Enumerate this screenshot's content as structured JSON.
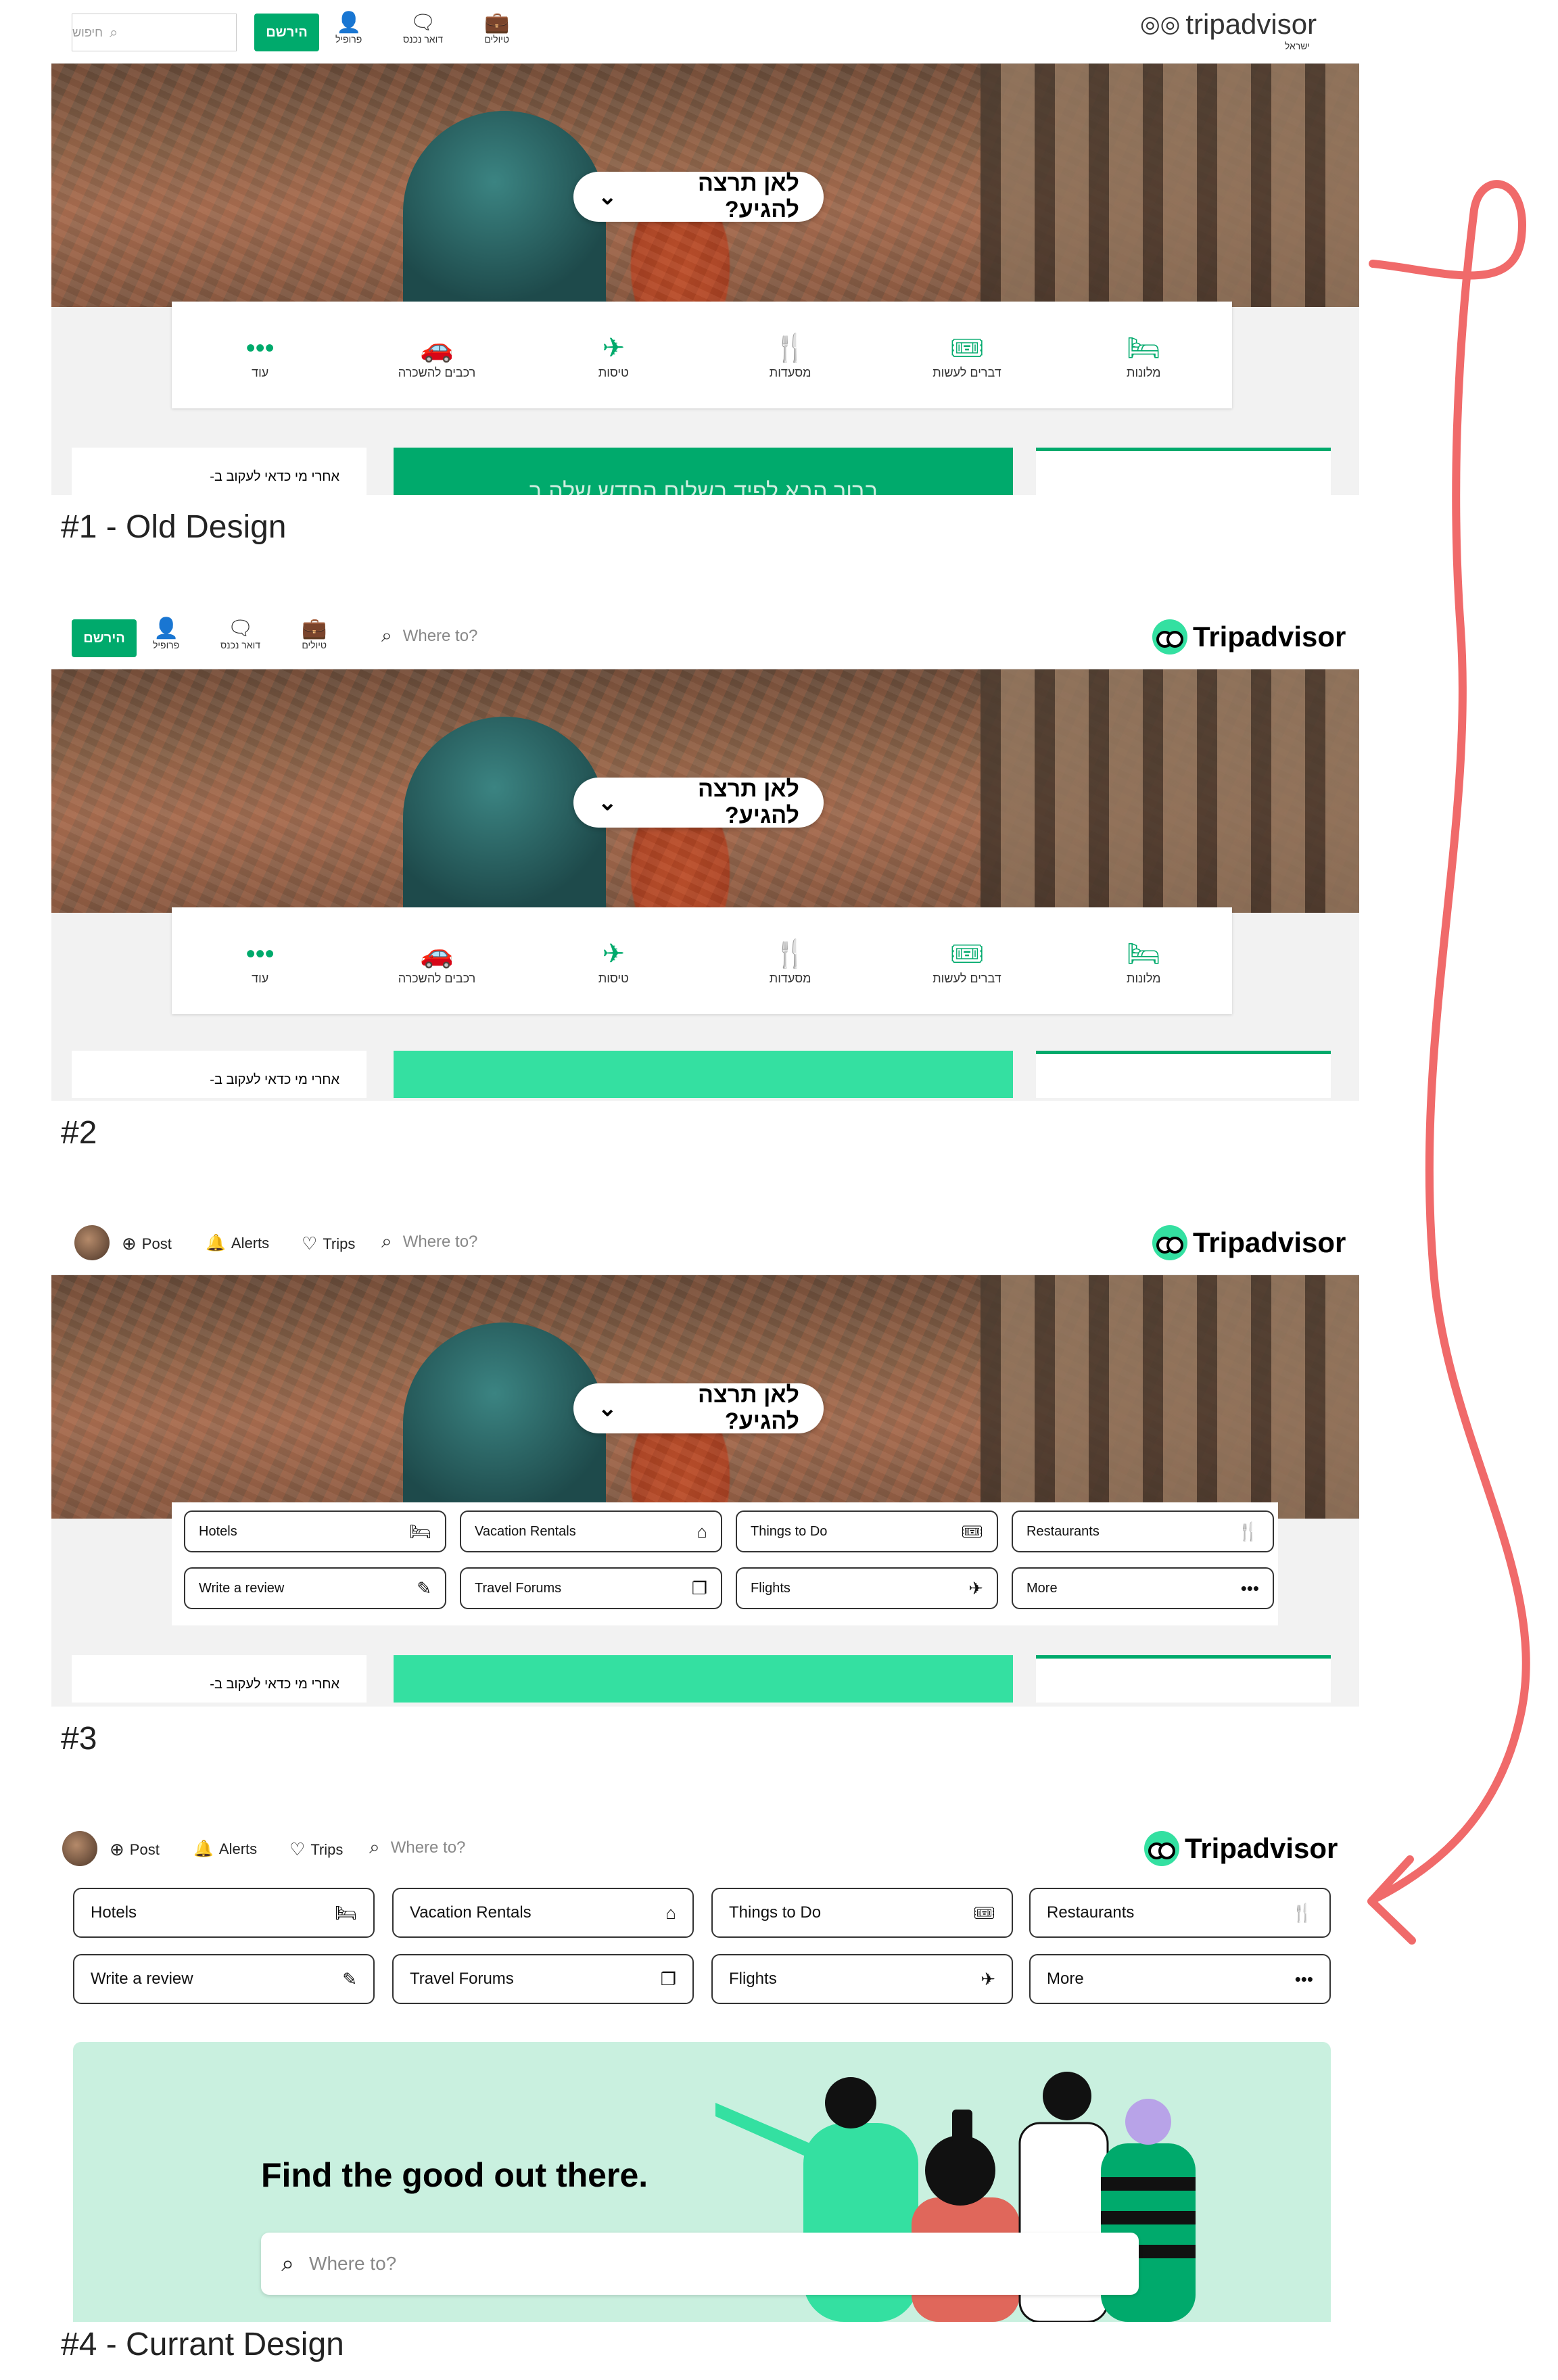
{
  "labels": {
    "d1": "#1 - Old Design",
    "d2": "#2",
    "d3": "#3",
    "d4": "#4 - Currant Design"
  },
  "old_header": {
    "logo_text": "tripadvisor",
    "logo_sub": "ישראל",
    "trips": "טיולים",
    "inbox": "דואר נכנס",
    "profile": "פרופיל",
    "signup": "הירשם",
    "search_placeholder": "חיפוש"
  },
  "new_header": {
    "logo_text": "Tripadvisor",
    "search_placeholder": "Where to?",
    "post": "Post",
    "alerts": "Alerts",
    "trips": "Trips"
  },
  "hero": {
    "pill_text": "לאן תרצה להגיע?"
  },
  "categories_he": [
    {
      "label": "מלונות",
      "icon": "bed-icon",
      "glyph": "🛏"
    },
    {
      "label": "דברים לעשות",
      "icon": "ticket-icon",
      "glyph": "🎟"
    },
    {
      "label": "מסעדות",
      "icon": "cutlery-icon",
      "glyph": "🍴"
    },
    {
      "label": "טיסות",
      "icon": "plane-icon",
      "glyph": "✈"
    },
    {
      "label": "רכבים להשכרה",
      "icon": "car-icon",
      "glyph": "🚗"
    },
    {
      "label": "עוד",
      "icon": "more-icon",
      "glyph": "•••"
    }
  ],
  "quick_links": [
    {
      "label": "Hotels",
      "icon": "bed-icon",
      "glyph": "🛏"
    },
    {
      "label": "Vacation Rentals",
      "icon": "house-icon",
      "glyph": "⌂"
    },
    {
      "label": "Things to Do",
      "icon": "ticket-icon",
      "glyph": "🎟"
    },
    {
      "label": "Restaurants",
      "icon": "cutlery-icon",
      "glyph": "🍴"
    },
    {
      "label": "Write a review",
      "icon": "edit-icon",
      "glyph": "✎"
    },
    {
      "label": "Travel Forums",
      "icon": "forum-icon",
      "glyph": "❐"
    },
    {
      "label": "Flights",
      "icon": "plane-icon",
      "glyph": "✈"
    },
    {
      "label": "More",
      "icon": "more-icon",
      "glyph": "•••"
    }
  ],
  "cards": {
    "recent_text": "אחרי מי כדאי לעקוב ב-",
    "banner_text": "ברוך הבא לפיד בשלום החדש שלה ב"
  },
  "current": {
    "headline": "Find the good out there.",
    "search_placeholder": "Where to?"
  },
  "colors": {
    "brand_green": "#00aa6c",
    "mint": "#34e0a1",
    "current_bg": "#c9f0df",
    "arrow": "#f06a6a"
  }
}
